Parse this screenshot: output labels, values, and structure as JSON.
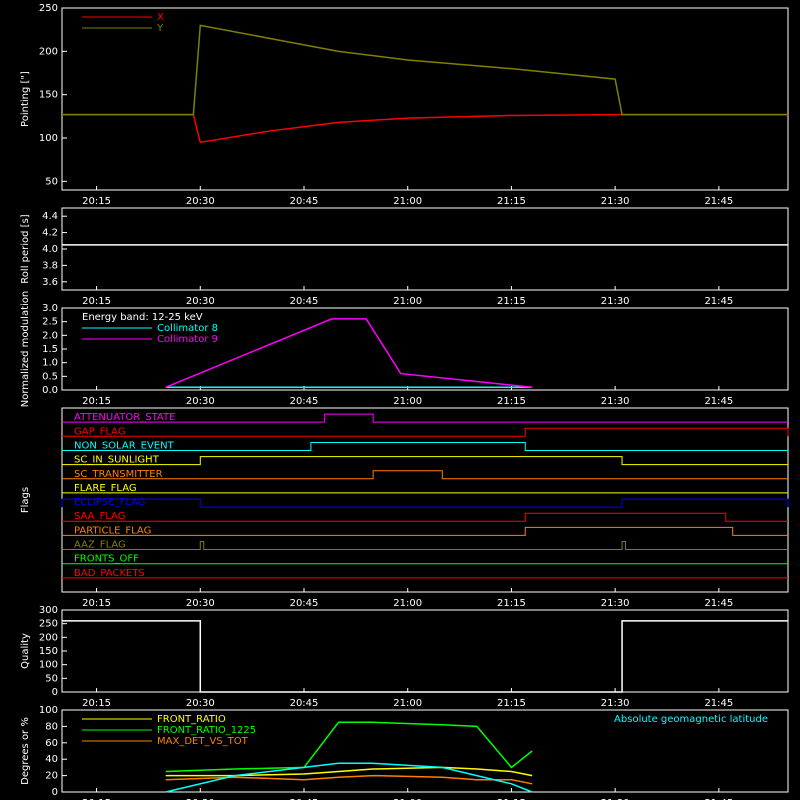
{
  "colors": {
    "background": "#000000",
    "axes": "#ffffff",
    "x_series": "#ff0000",
    "y_series": "#808000",
    "roll": "#ffffff",
    "collimator8": "#00ffff",
    "collimator9": "#ff00ff",
    "latitude": "#00ffff",
    "front_ratio": "#ffff00",
    "front_ratio_1225": "#00ff00",
    "max_det": "#ff8000"
  },
  "time_ticks": [
    "20:15",
    "20:30",
    "20:45",
    "21:00",
    "21:15",
    "21:30",
    "21:45"
  ],
  "chart_data": [
    {
      "id": "pointing",
      "type": "line",
      "ylabel": "Pointing [\"]",
      "ylim": [
        40,
        250
      ],
      "yticks": [
        "50",
        "100",
        "150",
        "200",
        "250"
      ],
      "legend": [
        {
          "name": "X",
          "color": "#ff0000"
        },
        {
          "name": "Y",
          "color": "#808000"
        }
      ],
      "x": [
        "20:10",
        "20:29",
        "20:30",
        "20:40",
        "20:50",
        "21:00",
        "21:15",
        "21:30",
        "21:31",
        "21:55"
      ],
      "series": [
        {
          "name": "X",
          "values": [
            127,
            127,
            95,
            108,
            118,
            123,
            126,
            127,
            127,
            127
          ]
        },
        {
          "name": "Y",
          "values": [
            127,
            127,
            230,
            215,
            200,
            190,
            180,
            168,
            127,
            127
          ]
        }
      ]
    },
    {
      "id": "roll",
      "type": "line",
      "ylabel": "Roll period [s]",
      "ylim": [
        3.5,
        4.5
      ],
      "yticks": [
        "3.6",
        "3.8",
        "4.0",
        "4.2",
        "4.4"
      ],
      "x": [
        "20:10",
        "21:55"
      ],
      "values": [
        4.05,
        4.05
      ]
    },
    {
      "id": "modulation",
      "type": "line",
      "ylabel": "Normalized modulation",
      "ylim": [
        0,
        3.0
      ],
      "yticks": [
        "0.0",
        "0.5",
        "1.0",
        "1.5",
        "2.0",
        "2.5",
        "3.0"
      ],
      "legend_title": "Energy band: 12-25 keV",
      "legend": [
        {
          "name": "Collimator 8",
          "color": "#00ffff"
        },
        {
          "name": "Collimator 9",
          "color": "#ff00ff"
        }
      ],
      "x": [
        "20:25",
        "20:49",
        "20:54",
        "20:59",
        "21:18"
      ],
      "series": [
        {
          "name": "Collimator 8",
          "values": [
            0.1,
            0.1,
            0.1,
            0.1,
            0.1
          ]
        },
        {
          "name": "Collimator 9",
          "values": [
            0.1,
            2.6,
            2.6,
            0.6,
            0.1
          ]
        }
      ]
    },
    {
      "id": "flags",
      "type": "line",
      "ylabel": "Flags",
      "flags": [
        {
          "name": "ATTENUATOR_STATE",
          "color": "#ff00ff",
          "on": [
            [
              "20:48",
              "20:55"
            ]
          ]
        },
        {
          "name": "GAP_FLAG",
          "color": "#ff0000",
          "on": [
            [
              "21:17",
              "21:55"
            ]
          ]
        },
        {
          "name": "NON_SOLAR_EVENT",
          "color": "#00ffff",
          "on": [
            [
              "20:46",
              "21:17"
            ]
          ]
        },
        {
          "name": "SC_IN_SUNLIGHT",
          "color": "#ffff00",
          "on": [
            [
              "20:30",
              "21:31"
            ]
          ]
        },
        {
          "name": "SC_TRANSMITTER",
          "color": "#ff8000",
          "on": [
            [
              "20:55",
              "21:05"
            ]
          ]
        },
        {
          "name": "FLARE_FLAG",
          "color": "#ffff00",
          "on": []
        },
        {
          "name": "ECLIPSE_FLAG",
          "color": "#0000ff",
          "on": [
            [
              "20:10",
              "20:30"
            ],
            [
              "21:31",
              "21:55"
            ]
          ]
        },
        {
          "name": "SAA_FLAG",
          "color": "#ff0000",
          "on": [
            [
              "21:17",
              "21:46"
            ]
          ]
        },
        {
          "name": "PARTICLE_FLAG",
          "color": "#ff8000",
          "on": [
            [
              "21:17",
              "21:47"
            ]
          ]
        },
        {
          "name": "AAZ_FLAG",
          "color": "#808000",
          "on": [
            [
              "20:30",
              "20:30.5"
            ],
            [
              "21:31",
              "21:31.5"
            ]
          ]
        },
        {
          "name": "FRONTS_OFF",
          "color": "#00ff00",
          "on": []
        },
        {
          "name": "BAD_PACKETS",
          "color": "#ff0000",
          "on": []
        }
      ]
    },
    {
      "id": "quality",
      "type": "line",
      "ylabel": "Quality",
      "ylim": [
        0,
        300
      ],
      "yticks": [
        "0",
        "50",
        "100",
        "150",
        "200",
        "250",
        "300"
      ],
      "x": [
        "20:10",
        "20:30",
        "20:30",
        "21:31",
        "21:31",
        "21:55"
      ],
      "values": [
        260,
        260,
        0,
        0,
        260,
        260
      ]
    },
    {
      "id": "ratios",
      "type": "line",
      "ylabel": "Degrees or %",
      "ylim": [
        0,
        100
      ],
      "yticks": [
        "0",
        "20",
        "40",
        "60",
        "80",
        "100"
      ],
      "legend": [
        {
          "name": "FRONT_RATIO",
          "color": "#ffff00"
        },
        {
          "name": "FRONT_RATIO_1225",
          "color": "#00ff00"
        },
        {
          "name": "MAX_DET_VS_TOT",
          "color": "#ff8000"
        }
      ],
      "right_legend": {
        "name": "Absolute geomagnetic latitude",
        "color": "#00ffff"
      },
      "x": [
        "20:25",
        "20:35",
        "20:45",
        "20:50",
        "20:55",
        "21:05",
        "21:10",
        "21:15",
        "21:18"
      ],
      "series": [
        {
          "name": "FRONT_RATIO",
          "values": [
            20,
            20,
            22,
            25,
            28,
            30,
            28,
            25,
            20
          ]
        },
        {
          "name": "FRONT_RATIO_1225",
          "values": [
            25,
            28,
            30,
            85,
            85,
            82,
            80,
            30,
            50
          ]
        },
        {
          "name": "MAX_DET_VS_TOT",
          "values": [
            15,
            18,
            15,
            18,
            20,
            18,
            15,
            15,
            10
          ]
        },
        {
          "name": "Absolute geomagnetic latitude",
          "values": [
            0,
            20,
            30,
            35,
            35,
            30,
            20,
            10,
            0
          ]
        }
      ]
    }
  ]
}
